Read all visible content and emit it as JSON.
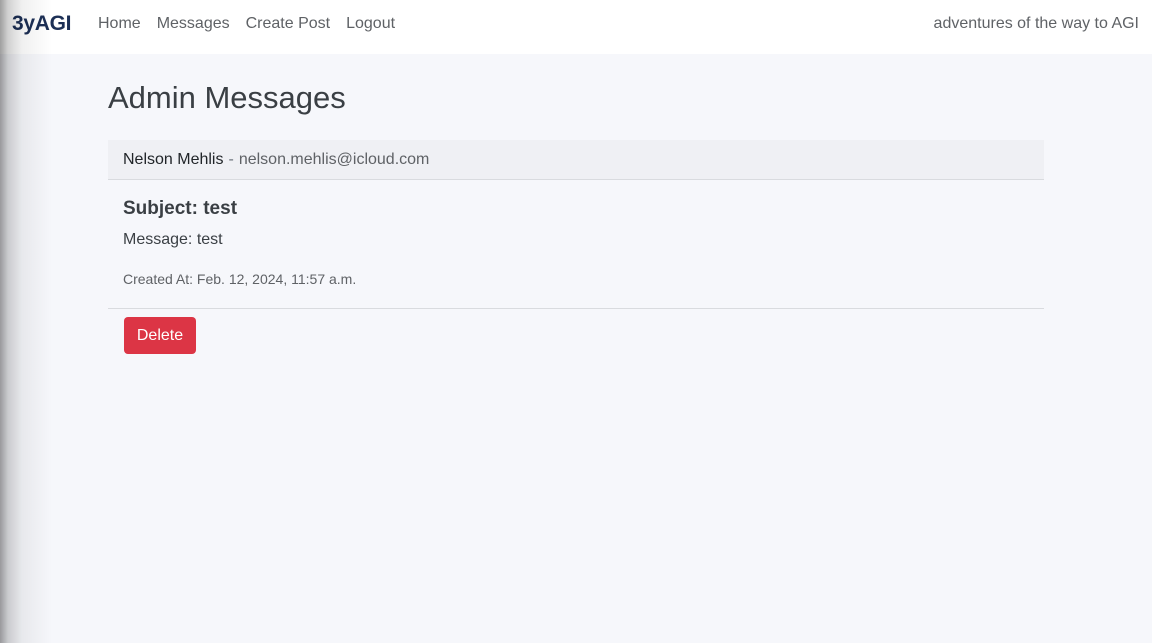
{
  "navbar": {
    "brand": "3yAGI",
    "links": [
      "Home",
      "Messages",
      "Create Post",
      "Logout"
    ],
    "tagline": "adventures of the way to AGI"
  },
  "main": {
    "title": "Admin Messages",
    "messages": [
      {
        "sender_name": "Nelson Mehlis",
        "separator": "-",
        "sender_email": "nelson.mehlis@icloud.com",
        "subject": "Subject: test",
        "message": "Message: test",
        "created_at": "Created At: Feb. 12, 2024, 11:57 a.m.",
        "delete_label": "Delete"
      }
    ]
  },
  "colors": {
    "brand": "#1c2f55",
    "danger": "#dc3545",
    "background": "#f6f7fb",
    "card_header": "#eff0f4"
  }
}
